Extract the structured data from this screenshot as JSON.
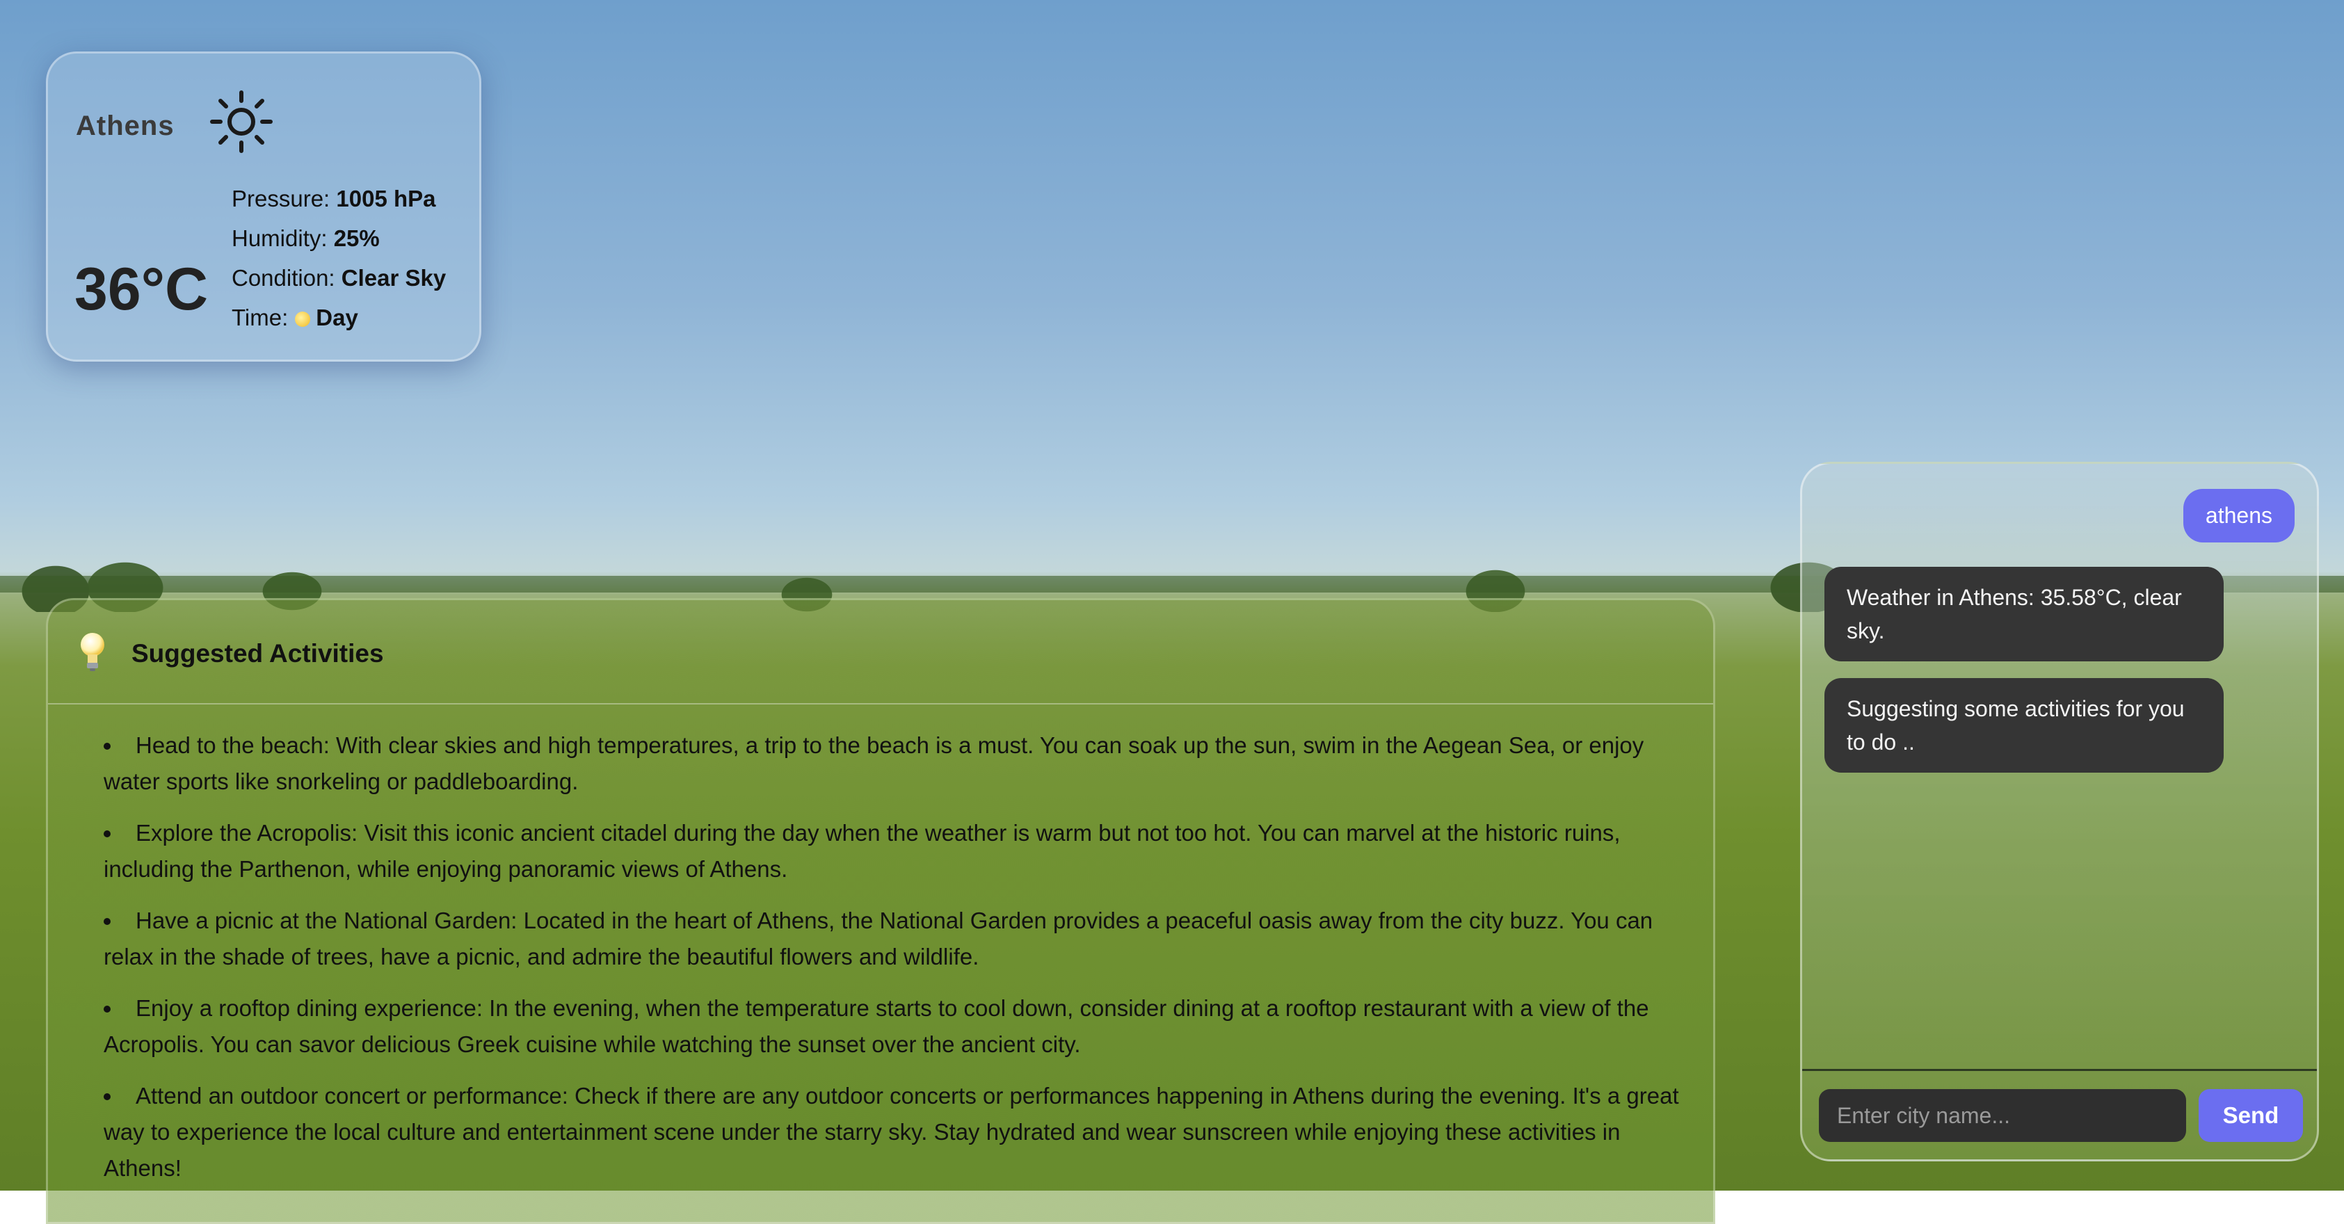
{
  "weather": {
    "city": "Athens",
    "icon": "sun-outline-icon",
    "temperature": "36°C",
    "pressure_label": "Pressure:",
    "pressure_value": "1005 hPa",
    "humidity_label": "Humidity:",
    "humidity_value": "25%",
    "condition_label": "Condition:",
    "condition_value": "Clear Sky",
    "time_label": "Time:",
    "time_icon": "sun-icon",
    "time_value": "Day"
  },
  "activities": {
    "icon": "lightbulb-icon",
    "title": "Suggested Activities",
    "items": [
      "Head to the beach: With clear skies and high temperatures, a trip to the beach is a must. You can soak up the sun, swim in the Aegean Sea, or enjoy water sports like snorkeling or paddleboarding.",
      "Explore the Acropolis: Visit this iconic ancient citadel during the day when the weather is warm but not too hot. You can marvel at the historic ruins, including the Parthenon, while enjoying panoramic views of Athens.",
      "Have a picnic at the National Garden: Located in the heart of Athens, the National Garden provides a peaceful oasis away from the city buzz. You can relax in the shade of trees, have a picnic, and admire the beautiful flowers and wildlife.",
      "Enjoy a rooftop dining experience: In the evening, when the temperature starts to cool down, consider dining at a rooftop restaurant with a view of the Acropolis. You can savor delicious Greek cuisine while watching the sunset over the ancient city.",
      "Attend an outdoor concert or performance: Check if there are any outdoor concerts or performances happening in Athens during the evening. It's a great way to experience the local culture and entertainment scene under the starry sky. Stay hydrated and wear sunscreen while enjoying these activities in Athens!"
    ]
  },
  "chat": {
    "messages": [
      {
        "role": "user",
        "text": "athens"
      },
      {
        "role": "bot",
        "text": "Weather in Athens: 35.58°C, clear sky."
      },
      {
        "role": "bot",
        "text": "Suggesting some activities for you to do .."
      }
    ],
    "input_placeholder": "Enter city name...",
    "input_value": "",
    "send_label": "Send"
  },
  "colors": {
    "accent": "#6b6ef0",
    "bot_bubble": "#353535"
  }
}
